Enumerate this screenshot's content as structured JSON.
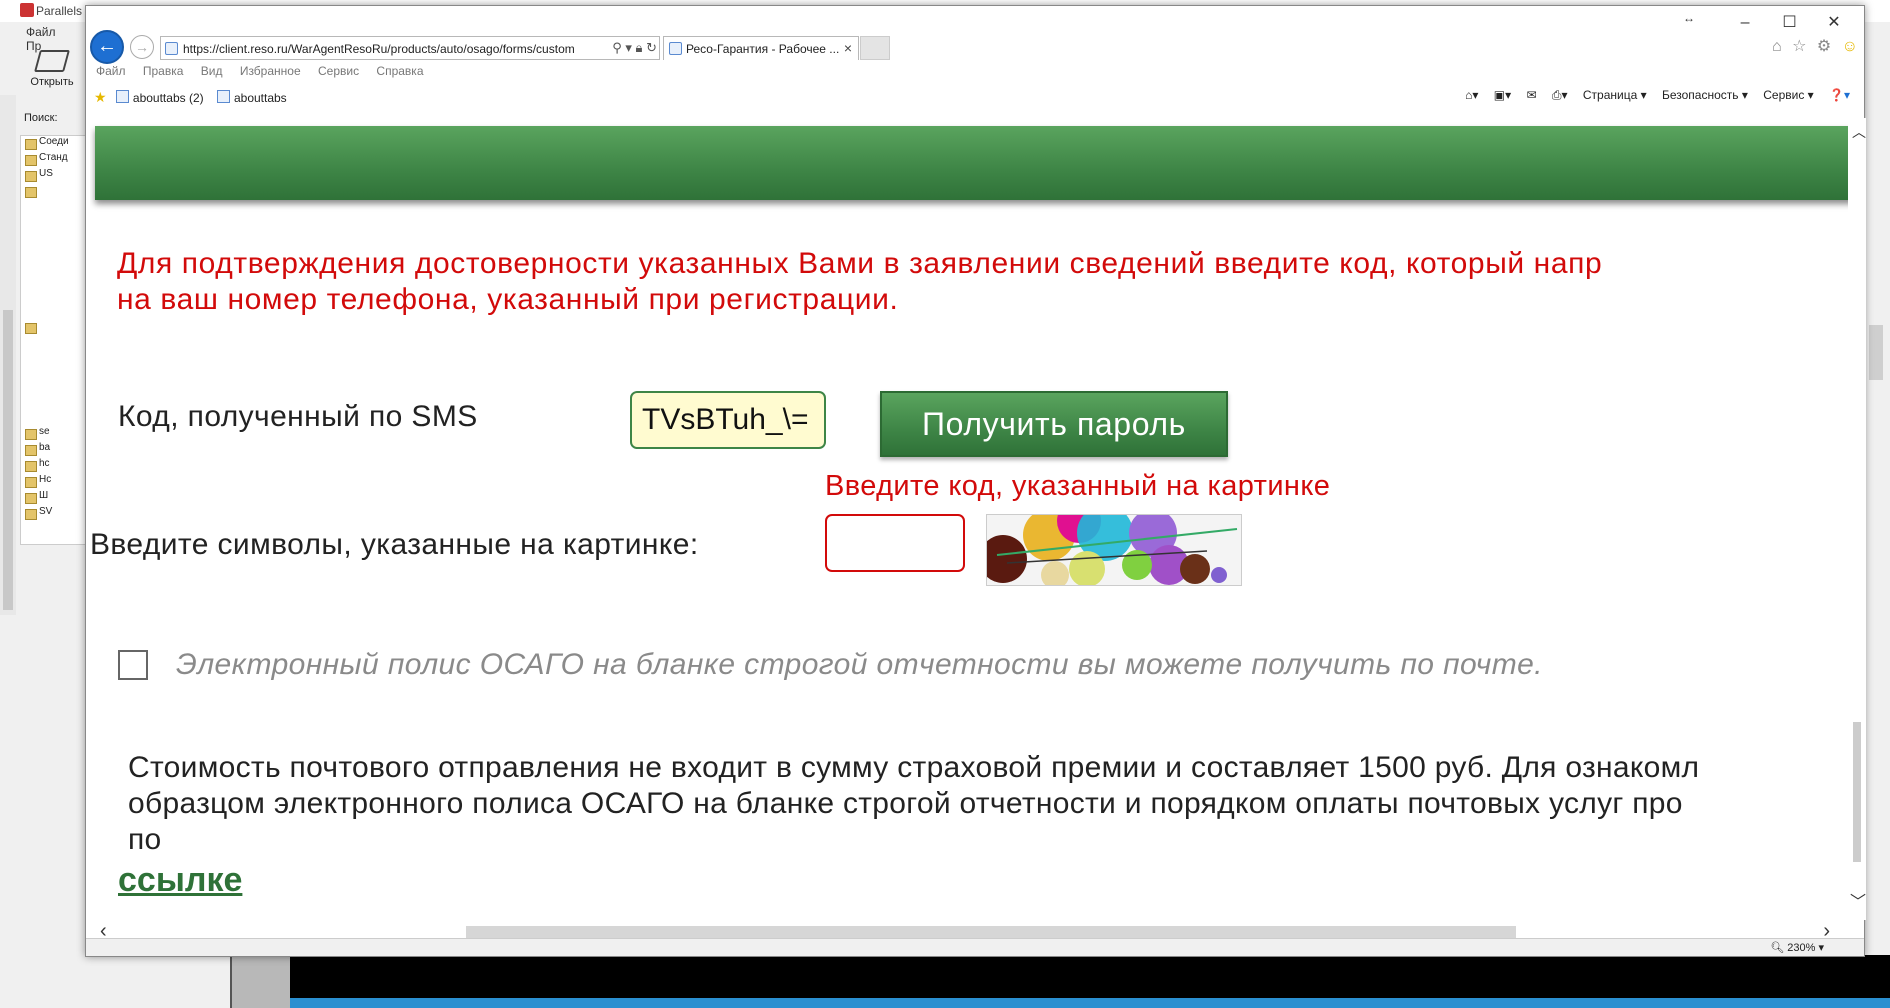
{
  "background_app": {
    "title": "Parallels",
    "menu": [
      "Файл",
      "Пр"
    ],
    "open_label": "Открыть",
    "search_label": "Поиск:",
    "tree_items": [
      "Соеди",
      "Станд",
      "US",
      "",
      "",
      "se",
      "ba",
      "hc",
      "Hc",
      "Ш",
      "SV"
    ]
  },
  "browser": {
    "address": "https://client.reso.ru/WarAgentResoRu/products/auto/osago/forms/custom",
    "tab_title": "Ресо-Гарантия - Рабочее ...",
    "menu": [
      "Файл",
      "Правка",
      "Вид",
      "Избранное",
      "Сервис",
      "Справка"
    ],
    "favorites": [
      "abouttabs (2)",
      "abouttabs"
    ],
    "command_bar": [
      "Страница ▾",
      "Безопасность ▾",
      "Сервис ▾"
    ],
    "zoom": "230%"
  },
  "form": {
    "notice_line1": "Для подтверждения достоверности указанных Вами в заявлении сведений введите код, который напр",
    "notice_line2": "на ваш номер телефона, указанный при регистрации.",
    "sms_label": "Код, полученный по SMS",
    "sms_value": "TVsBTuh_\\=",
    "get_password_button": "Получить пароль",
    "captcha_error": "Введите код, указанный на картинке",
    "captcha_label": "Введите символы, указанные на картинке:",
    "captcha_value": "",
    "mail_checkbox_checked": false,
    "mail_label": "Электронный полис ОСАГО на бланке строгой отчетности вы можете получить по почте.",
    "postal_line1": "Стоимость почтового отправления не входит в сумму страховой премии и составляет 1500 руб. Для ознакомл",
    "postal_line2": "образцом электронного полиса ОСАГО на бланке строгой отчетности и порядком оплаты почтовых услуг про",
    "postal_line3": "по",
    "link_text": "ссылке"
  },
  "colors": {
    "brand_green": "#3e8546",
    "error_red": "#d20a0a",
    "input_yellow": "#fffbd0"
  }
}
